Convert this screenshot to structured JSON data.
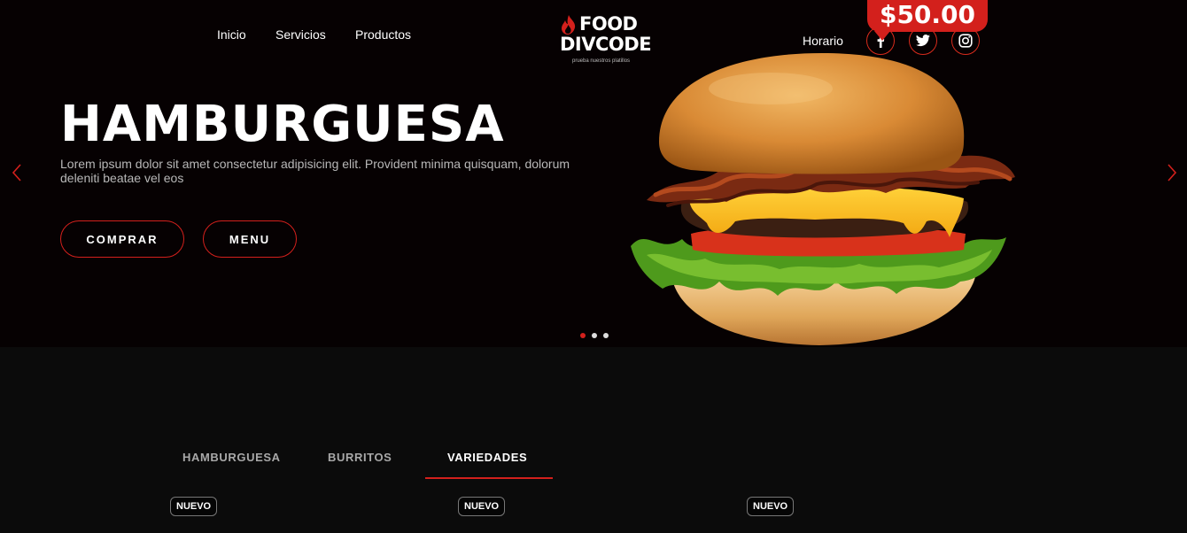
{
  "nav": {
    "items": [
      "Inicio",
      "Servicios",
      "Productos"
    ],
    "horario": "Horario"
  },
  "logo": {
    "line1": "FOOD",
    "line2": "DIVCODE",
    "tagline": "prueba nuestros platillos"
  },
  "social": [
    "facebook-icon",
    "twitter-icon",
    "instagram-icon"
  ],
  "price": "$50.00",
  "hero": {
    "title": "HAMBURGUESA",
    "description": "Lorem ipsum dolor sit amet consectetur adipisicing elit. Provident minima quisquam, dolorum deleniti beatae vel eos",
    "buttons": [
      "COMPRAR",
      "MENU"
    ],
    "slides": 3,
    "active_slide": 1
  },
  "tabs": {
    "items": [
      "HAMBURGUESA",
      "BURRITOS",
      "VARIEDADES"
    ],
    "active": "VARIEDADES"
  },
  "badges": [
    "NUEVO",
    "NUEVO",
    "NUEVO"
  ],
  "colors": {
    "accent": "#d3201c",
    "hero_bg": "#060102",
    "panel_bg": "#0b0b0b"
  }
}
